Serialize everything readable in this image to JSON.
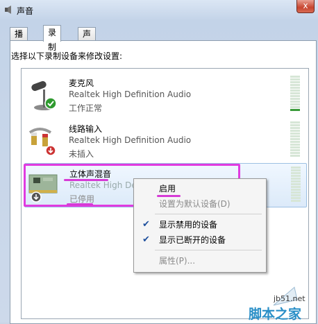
{
  "window": {
    "title": "声音",
    "close_label": "x"
  },
  "tabs": [
    {
      "label": "播放",
      "active": false
    },
    {
      "label": "录制",
      "active": true
    },
    {
      "label": "声音",
      "active": false
    }
  ],
  "prompt": "选择以下录制设备来修改设置:",
  "devices": [
    {
      "name": "麦克风",
      "driver": "Realtek High Definition Audio",
      "status": "工作正常",
      "icon": "microphone-icon",
      "badge": "check-badge-icon"
    },
    {
      "name": "线路输入",
      "driver": "Realtek High Definition Audio",
      "status": "未插入",
      "icon": "line-in-cable-icon",
      "badge": "down-arrow-badge-icon"
    },
    {
      "name": "立体声混音",
      "driver": "Realtek High Defi",
      "status": "已停用",
      "icon": "sound-card-icon",
      "badge": "down-arrow-badge-icon"
    }
  ],
  "context_menu": {
    "items": [
      {
        "label": "启用",
        "checked": false,
        "disabled": false
      },
      {
        "label": "设置为默认设备(D)",
        "checked": false,
        "disabled": true
      },
      {
        "label": "显示禁用的设备",
        "checked": true,
        "disabled": false
      },
      {
        "label": "显示已断开的设备",
        "checked": true,
        "disabled": false
      },
      {
        "label": "属性(P)...",
        "checked": false,
        "disabled": true
      }
    ]
  },
  "watermark": {
    "url": "jb51.net",
    "text": "脚本之家"
  },
  "colors": {
    "highlight": "#e03be0",
    "meter_green": "#3a9a3a",
    "check": "#1c4e9c"
  }
}
